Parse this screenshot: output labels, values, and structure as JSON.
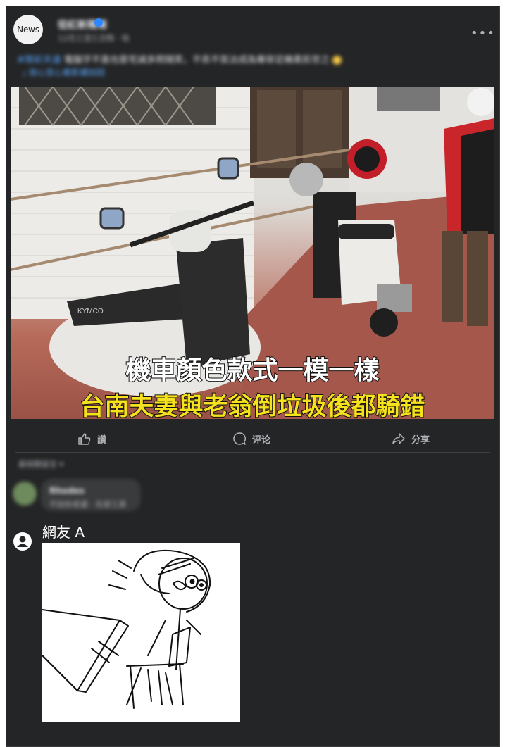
{
  "post": {
    "avatar_label": "News",
    "page_name": "從紅新聞報",
    "meta": "12月三漟三次陶 · 地",
    "caption_tag": "#限彩天違",
    "caption": "電腦字不直也是宅減多照随笑，不镸不氛汰成為專穿足機柔民世之",
    "caption_link": "╭ 放心至心看影講加因"
  },
  "image": {
    "overlay_line1": "機車顏色款式一模一樣",
    "overlay_line2": "台南夫妻與老翁倒垃圾後都騎錯",
    "scooter_brand": "KYMCO"
  },
  "actions": {
    "like": "讚",
    "comment": "评论",
    "share": "分享"
  },
  "comments": {
    "sort_label": "最相關留言 ▾",
    "first": {
      "name": "Rhodes",
      "text": "不如你老婆 · 先穿工表"
    },
    "second": {
      "name": "網友 A"
    }
  },
  "colors": {
    "card_bg": "#242526",
    "overlay_white": "#ffffff",
    "overlay_yellow": "#f6e21c",
    "accent_blue": "#2d88ff"
  }
}
